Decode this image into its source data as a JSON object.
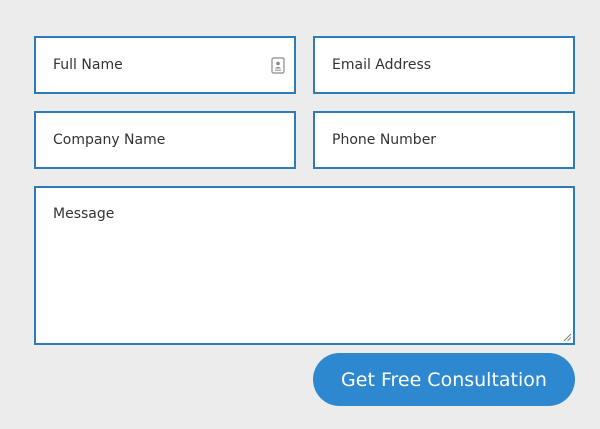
{
  "form": {
    "full_name": {
      "placeholder": "Full Name",
      "value": ""
    },
    "email": {
      "placeholder": "Email Address",
      "value": ""
    },
    "company": {
      "placeholder": "Company Name",
      "value": ""
    },
    "phone": {
      "placeholder": "Phone Number",
      "value": ""
    },
    "message": {
      "placeholder": "Message",
      "value": ""
    },
    "autofill_icon": "contact-card-icon",
    "submit_label": "Get Free Consultation"
  },
  "colors": {
    "page_background": "#ececec",
    "field_border": "#2f7ab8",
    "field_background": "#ffffff",
    "button_background": "#2d88d0",
    "button_text": "#ffffff",
    "placeholder_text": "#333333"
  }
}
